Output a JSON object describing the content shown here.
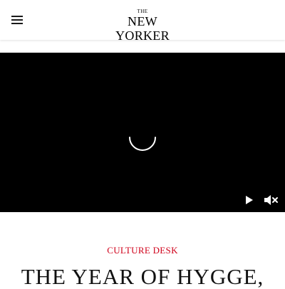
{
  "header": {
    "menu_icon": "hamburger-menu-icon",
    "logo_the": "THE",
    "logo_name": "NEW YORKER"
  },
  "video": {
    "state": "loading",
    "controls": {
      "play_icon": "play-icon",
      "mute_icon": "volume-muted-icon"
    }
  },
  "article": {
    "rubric": "CULTURE DESK",
    "headline": "THE YEAR OF HYGGE,"
  },
  "colors": {
    "rubric": "#d0021b",
    "video_background": "#000000",
    "page_background": "#ffffff"
  }
}
